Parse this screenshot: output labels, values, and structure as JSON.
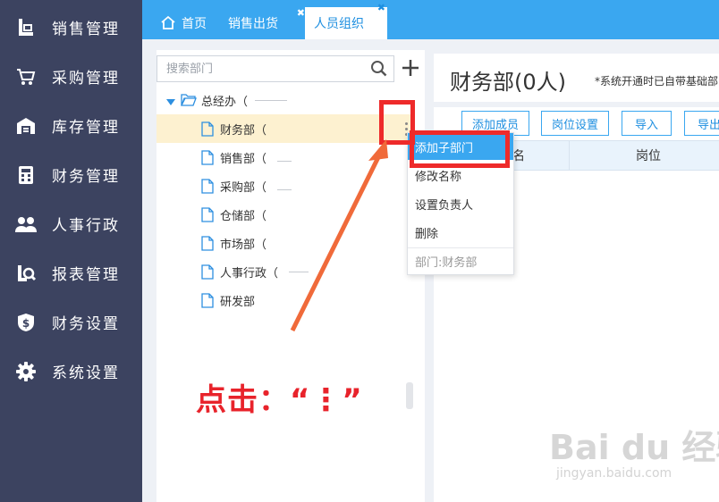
{
  "sidebar": {
    "items": [
      {
        "label": "销售管理",
        "icon": "sales-icon"
      },
      {
        "label": "采购管理",
        "icon": "cart-icon"
      },
      {
        "label": "库存管理",
        "icon": "warehouse-icon"
      },
      {
        "label": "财务管理",
        "icon": "calculator-icon"
      },
      {
        "label": "人事行政",
        "icon": "people-icon"
      },
      {
        "label": "报表管理",
        "icon": "report-icon"
      },
      {
        "label": "财务设置",
        "icon": "money-shield-icon"
      },
      {
        "label": "系统设置",
        "icon": "gear-icon"
      }
    ]
  },
  "tabs": {
    "home": "首页",
    "sales_out": "销售出货",
    "org": "人员组织",
    "close_glyph": "✖"
  },
  "tree": {
    "search_placeholder": "搜索部门",
    "root": "总经办（",
    "nodes": [
      {
        "label": "财务部（"
      },
      {
        "label": "销售部（"
      },
      {
        "label": "采购部（"
      },
      {
        "label": "仓储部（"
      },
      {
        "label": "市场部（"
      },
      {
        "label": "人事行政（"
      },
      {
        "label": "研发部"
      }
    ]
  },
  "main": {
    "title": "财务部(0人)",
    "note": "*系统开通时已自带基础部",
    "buttons": {
      "add_member": "添加成员",
      "post_setting": "岗位设置",
      "import": "导入",
      "export": "导出"
    },
    "columns": {
      "name": "名",
      "post": "岗位"
    }
  },
  "context_menu": {
    "items": [
      "添加子部门",
      "修改名称",
      "设置负责人",
      "删除"
    ],
    "footer": "部门:财务部"
  },
  "annotation": {
    "text": "点击：“⋮”"
  },
  "watermark": {
    "main": "Bai du 经验",
    "sub": "jingyan.baidu.com"
  },
  "colors": {
    "sidebar_bg": "#3c4360",
    "tabbar_bg": "#3aa7f0",
    "selected_row": "#fdf1d0",
    "annotation_red": "#ee2a2a"
  }
}
